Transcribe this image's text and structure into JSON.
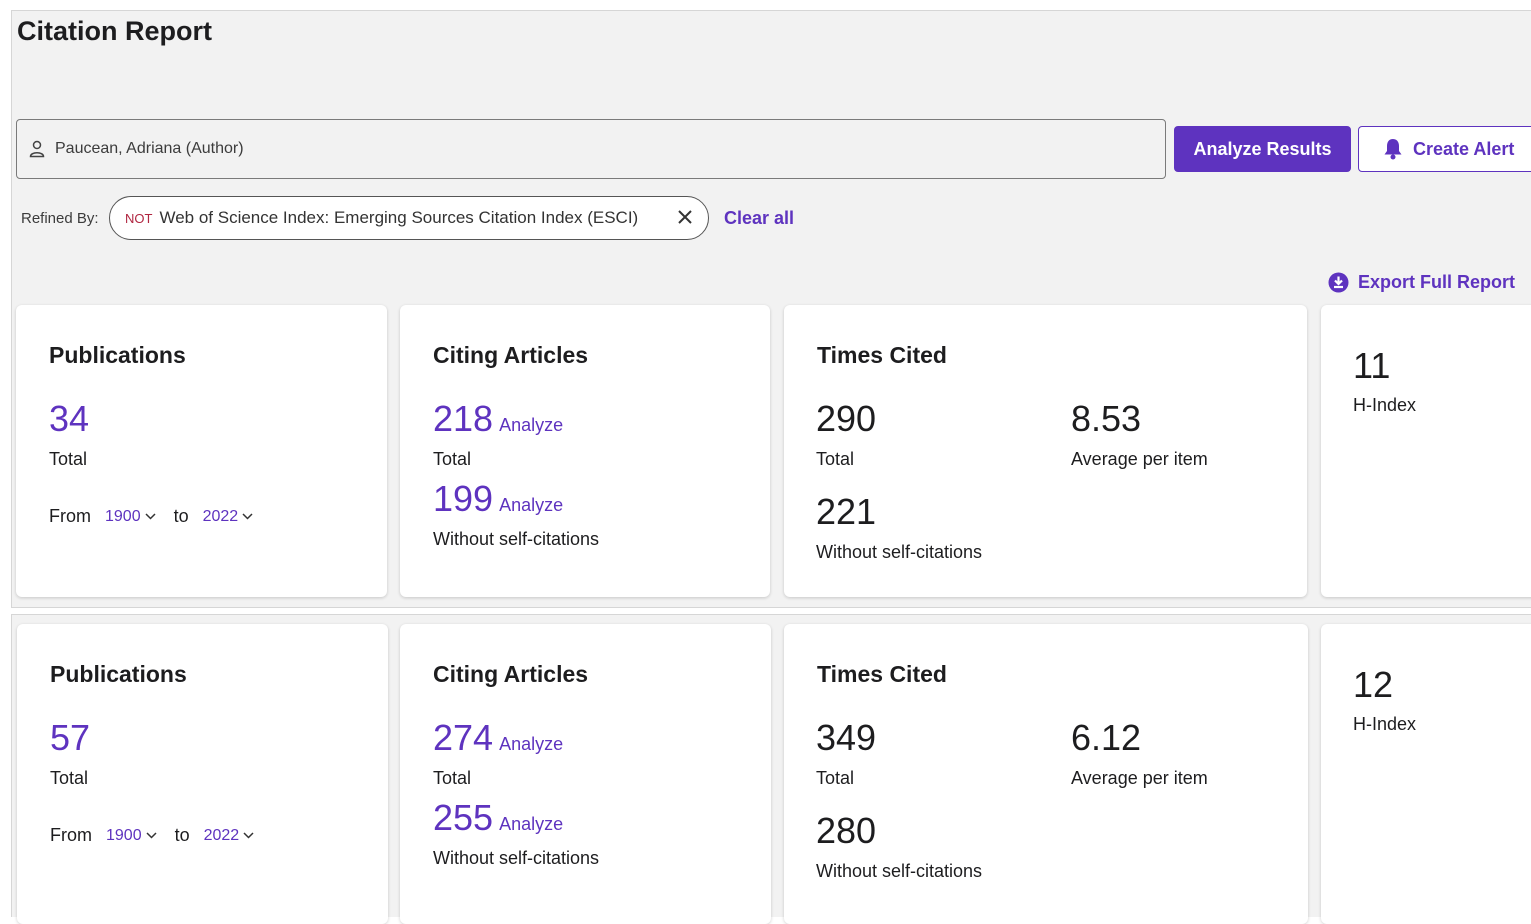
{
  "page": {
    "title": "Citation Report"
  },
  "search": {
    "query": "Paucean, Adriana (Author)"
  },
  "actions": {
    "analyze_label": "Analyze Results",
    "alert_label": "Create Alert",
    "export_label": "Export Full Report"
  },
  "refine": {
    "label": "Refined By:",
    "chip_not": "NOT",
    "chip_text": "Web of Science Index: Emerging Sources Citation Index (ESCI)",
    "clear_label": "Clear all"
  },
  "reports": [
    {
      "publications": {
        "title": "Publications",
        "total": "34",
        "total_label": "Total",
        "from_label": "From",
        "from_year": "1900",
        "to_label": "to",
        "to_year": "2022"
      },
      "citing": {
        "title": "Citing Articles",
        "total": "218",
        "total_label": "Total",
        "without": "199",
        "without_label": "Without self-citations",
        "analyze": "Analyze"
      },
      "times_cited": {
        "title": "Times Cited",
        "total": "290",
        "total_label": "Total",
        "average": "8.53",
        "average_label": "Average per item",
        "without": "221",
        "without_label": "Without self-citations"
      },
      "h_index": {
        "value": "11",
        "label": "H-Index"
      }
    },
    {
      "publications": {
        "title": "Publications",
        "total": "57",
        "total_label": "Total",
        "from_label": "From",
        "from_year": "1900",
        "to_label": "to",
        "to_year": "2022"
      },
      "citing": {
        "title": "Citing Articles",
        "total": "274",
        "total_label": "Total",
        "without": "255",
        "without_label": "Without self-citations",
        "analyze": "Analyze"
      },
      "times_cited": {
        "title": "Times Cited",
        "total": "349",
        "total_label": "Total",
        "average": "6.12",
        "average_label": "Average per item",
        "without": "280",
        "without_label": "Without self-citations"
      },
      "h_index": {
        "value": "12",
        "label": "H-Index"
      }
    }
  ],
  "colors": {
    "accent": "#5e33bf",
    "panel": "#f2f2f2",
    "not_tag": "#b02540"
  },
  "icons": [
    "person-icon",
    "bell-icon",
    "close-icon",
    "download-icon",
    "chevron-down-icon"
  ]
}
